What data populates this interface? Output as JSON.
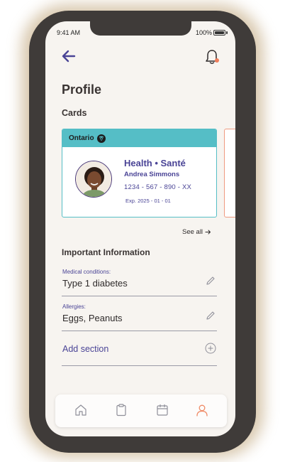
{
  "status_bar": {
    "time": "9:41 AM",
    "battery": "100%"
  },
  "header": {
    "back_icon": "arrow-left-icon",
    "notification_icon": "bell-icon",
    "notification_badge_color": "#ef7d5b"
  },
  "page": {
    "title": "Profile",
    "cards_section_label": "Cards"
  },
  "health_card": {
    "brand": "Ontario",
    "title": "Health • Santé",
    "holder_name": "Andrea Simmons",
    "number": "1234 - 567 - 890 - XX",
    "expiry": "Exp. 2025 - 01 - 01",
    "header_color": "#55bec6",
    "text_color": "#4a4496"
  },
  "see_all": {
    "label": "See all"
  },
  "important_info": {
    "title": "Important Information",
    "fields": [
      {
        "label": "Medical conditions:",
        "value": "Type 1 diabetes"
      },
      {
        "label": "Allergies:",
        "value": "Eggs, Peanuts"
      }
    ],
    "add_section_label": "Add section"
  },
  "tab_bar": {
    "tabs": [
      {
        "icon": "home-icon",
        "active": false
      },
      {
        "icon": "clipboard-icon",
        "active": false
      },
      {
        "icon": "calendar-icon",
        "active": false
      },
      {
        "icon": "user-icon",
        "active": true
      }
    ],
    "active_color": "#ef8a66",
    "inactive_color": "#8f8f99"
  }
}
